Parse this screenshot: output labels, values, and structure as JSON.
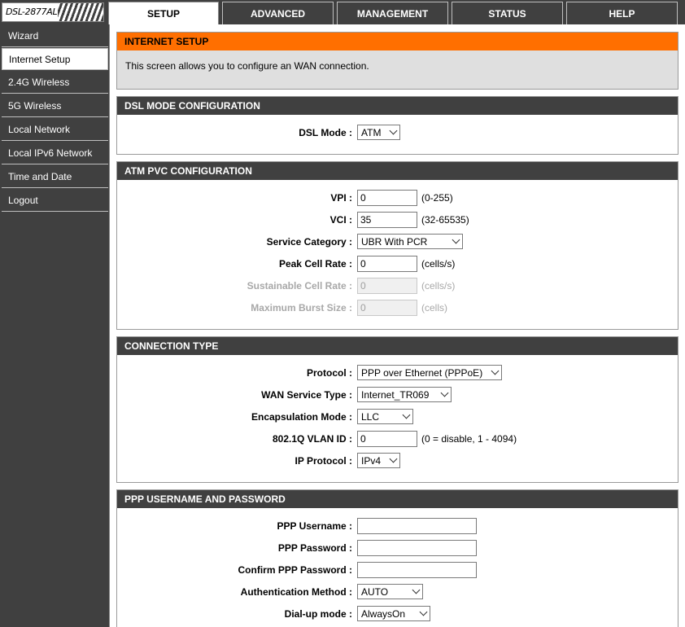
{
  "logo": {
    "model": "DSL-2877AL"
  },
  "tabs": [
    {
      "label": "SETUP",
      "active": true
    },
    {
      "label": "ADVANCED",
      "active": false
    },
    {
      "label": "MANAGEMENT",
      "active": false
    },
    {
      "label": "STATUS",
      "active": false
    },
    {
      "label": "HELP",
      "active": false
    }
  ],
  "sidebar": {
    "items": [
      {
        "label": "Wizard"
      },
      {
        "label": "Internet Setup",
        "active": true
      },
      {
        "label": "2.4G Wireless"
      },
      {
        "label": "5G Wireless"
      },
      {
        "label": "Local Network"
      },
      {
        "label": "Local IPv6 Network"
      },
      {
        "label": "Time and Date"
      },
      {
        "label": "Logout"
      }
    ]
  },
  "internet_setup": {
    "title": "INTERNET SETUP",
    "description": "This screen allows you to configure an WAN connection."
  },
  "dsl_mode": {
    "title": "DSL MODE CONFIGURATION",
    "label": "DSL Mode :",
    "value": "ATM"
  },
  "atm_pvc": {
    "title": "ATM PVC CONFIGURATION",
    "vpi": {
      "label": "VPI :",
      "value": "0",
      "hint": "(0-255)"
    },
    "vci": {
      "label": "VCI :",
      "value": "35",
      "hint": "(32-65535)"
    },
    "service_category": {
      "label": "Service Category :",
      "value": "UBR With PCR"
    },
    "peak_cell_rate": {
      "label": "Peak Cell Rate :",
      "value": "0",
      "hint": "(cells/s)"
    },
    "sustainable_cell_rate": {
      "label": "Sustainable Cell Rate :",
      "value": "0",
      "hint": "(cells/s)"
    },
    "max_burst_size": {
      "label": "Maximum Burst Size :",
      "value": "0",
      "hint": "(cells)"
    }
  },
  "connection_type": {
    "title": "CONNECTION TYPE",
    "protocol": {
      "label": "Protocol :",
      "value": "PPP over Ethernet (PPPoE)"
    },
    "wan_service_type": {
      "label": "WAN Service Type :",
      "value": "Internet_TR069"
    },
    "encapsulation_mode": {
      "label": "Encapsulation Mode :",
      "value": "LLC"
    },
    "vlan_id": {
      "label": "802.1Q VLAN ID :",
      "value": "0",
      "hint": "(0 = disable, 1 - 4094)"
    },
    "ip_protocol": {
      "label": "IP Protocol :",
      "value": "IPv4"
    }
  },
  "ppp": {
    "title": "PPP USERNAME AND PASSWORD",
    "username": {
      "label": "PPP Username :",
      "value": ""
    },
    "password": {
      "label": "PPP Password :",
      "value": ""
    },
    "confirm_password": {
      "label": "Confirm PPP Password :",
      "value": ""
    },
    "auth_method": {
      "label": "Authentication Method :",
      "value": "AUTO"
    },
    "dialup_mode": {
      "label": "Dial-up mode :",
      "value": "AlwaysOn"
    }
  }
}
